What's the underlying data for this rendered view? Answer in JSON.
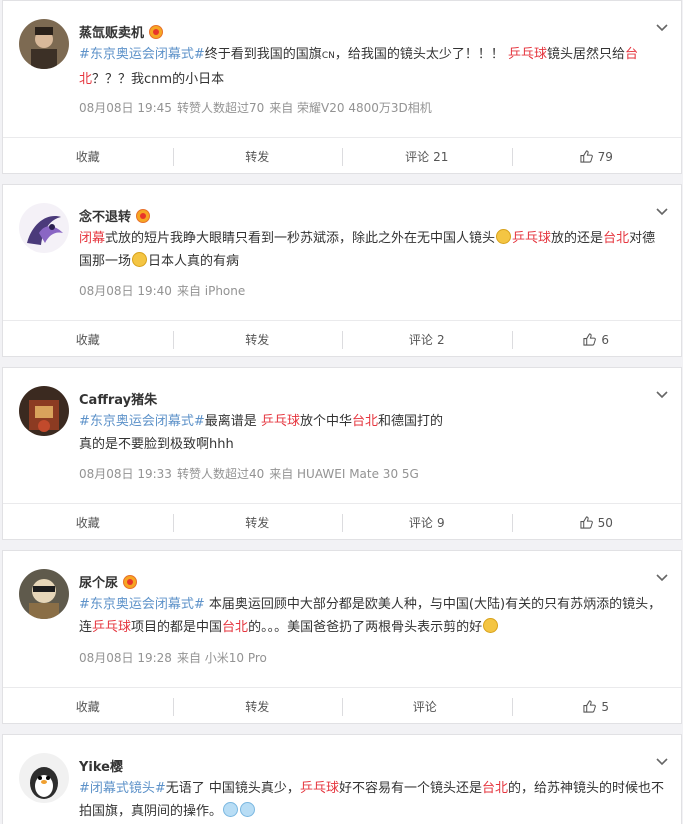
{
  "posts": [
    {
      "username": "蒸氙贩卖机",
      "content": [
        {
          "t": "#东京奥运会闭幕式#",
          "c": "topic"
        },
        {
          "t": "终于看到我国的国旗",
          "c": ""
        },
        {
          "t": "CN",
          "c": "small"
        },
        {
          "t": "，给我国的镜头太少了！！！ ",
          "c": ""
        },
        {
          "t": "乒乓球",
          "c": "kw"
        },
        {
          "t": "镜头居然只给",
          "c": ""
        },
        {
          "t": "台北",
          "c": "kw"
        },
        {
          "t": "？？？我cnm的小日本",
          "c": ""
        }
      ],
      "meta": [
        "08月08日 19:45",
        "转赞人数超过70",
        "来自 荣耀V20 4800万3D相机"
      ],
      "actions": {
        "fav": "收藏",
        "repost": "转发",
        "comment": "评论",
        "comment_count": "21",
        "likes": "79"
      }
    },
    {
      "username": "念不退转",
      "content": [
        {
          "t": "闭幕",
          "c": "kw"
        },
        {
          "t": "式放的短片我睁大眼睛只看到一秒苏斌添，除此之外在无中国人镜头",
          "c": ""
        },
        {
          "t": "",
          "c": "emoji"
        },
        {
          "t": "乒乓球",
          "c": "kw"
        },
        {
          "t": "放的还是",
          "c": ""
        },
        {
          "t": "台北",
          "c": "kw"
        },
        {
          "t": "对德国那一场",
          "c": ""
        },
        {
          "t": "",
          "c": "emoji"
        },
        {
          "t": "日本人真的有病",
          "c": ""
        }
      ],
      "meta": [
        "08月08日 19:40",
        "来自 iPhone"
      ],
      "actions": {
        "fav": "收藏",
        "repost": "转发",
        "comment": "评论",
        "comment_count": "2",
        "likes": "6"
      }
    },
    {
      "username": "Caffray猪朱",
      "content": [
        {
          "t": "#东京奥运会闭幕式#",
          "c": "topic"
        },
        {
          "t": "最离谱是 ",
          "c": ""
        },
        {
          "t": "乒乓球",
          "c": "kw"
        },
        {
          "t": "放个中华",
          "c": ""
        },
        {
          "t": "台北",
          "c": "kw"
        },
        {
          "t": "和德国打的",
          "c": ""
        },
        {
          "t": "BR",
          "c": "br"
        },
        {
          "t": "真的是不要脸到极致啊hhh",
          "c": ""
        }
      ],
      "meta": [
        "08月08日 19:33",
        "转赞人数超过40",
        "来自 HUAWEI Mate 30 5G"
      ],
      "actions": {
        "fav": "收藏",
        "repost": "转发",
        "comment": "评论",
        "comment_count": "9",
        "likes": "50"
      }
    },
    {
      "username": "尿个尿",
      "content": [
        {
          "t": "#东京奥运会闭幕式#",
          "c": "topic"
        },
        {
          "t": " 本届奥运回顾中大部分都是欧美人种，与中国(大陆)有关的只有苏炳添的镜头，连",
          "c": ""
        },
        {
          "t": "乒乓球",
          "c": "kw"
        },
        {
          "t": "项目的都是中国",
          "c": ""
        },
        {
          "t": "台北",
          "c": "kw"
        },
        {
          "t": "的。。。美国爸爸扔了两根骨头表示剪的好",
          "c": ""
        },
        {
          "t": "",
          "c": "emoji"
        }
      ],
      "meta": [
        "08月08日 19:28",
        "来自 小米10 Pro"
      ],
      "actions": {
        "fav": "收藏",
        "repost": "转发",
        "comment": "评论",
        "comment_count": "",
        "likes": "5"
      }
    },
    {
      "username": "Yike樱",
      "content": [
        {
          "t": "#闭幕式镜头#",
          "c": "topic"
        },
        {
          "t": "无语了 中国镜头真少，",
          "c": ""
        },
        {
          "t": "乒乓球",
          "c": "kw"
        },
        {
          "t": "好不容易有一个镜头还是",
          "c": ""
        },
        {
          "t": "台北",
          "c": "kw"
        },
        {
          "t": "的，给苏神镜头的时候也不拍国旗，真阴间的操作。",
          "c": ""
        },
        {
          "t": "",
          "c": "emoji-blue"
        },
        {
          "t": "",
          "c": "emoji-blue"
        }
      ],
      "meta": [],
      "actions": null
    }
  ]
}
